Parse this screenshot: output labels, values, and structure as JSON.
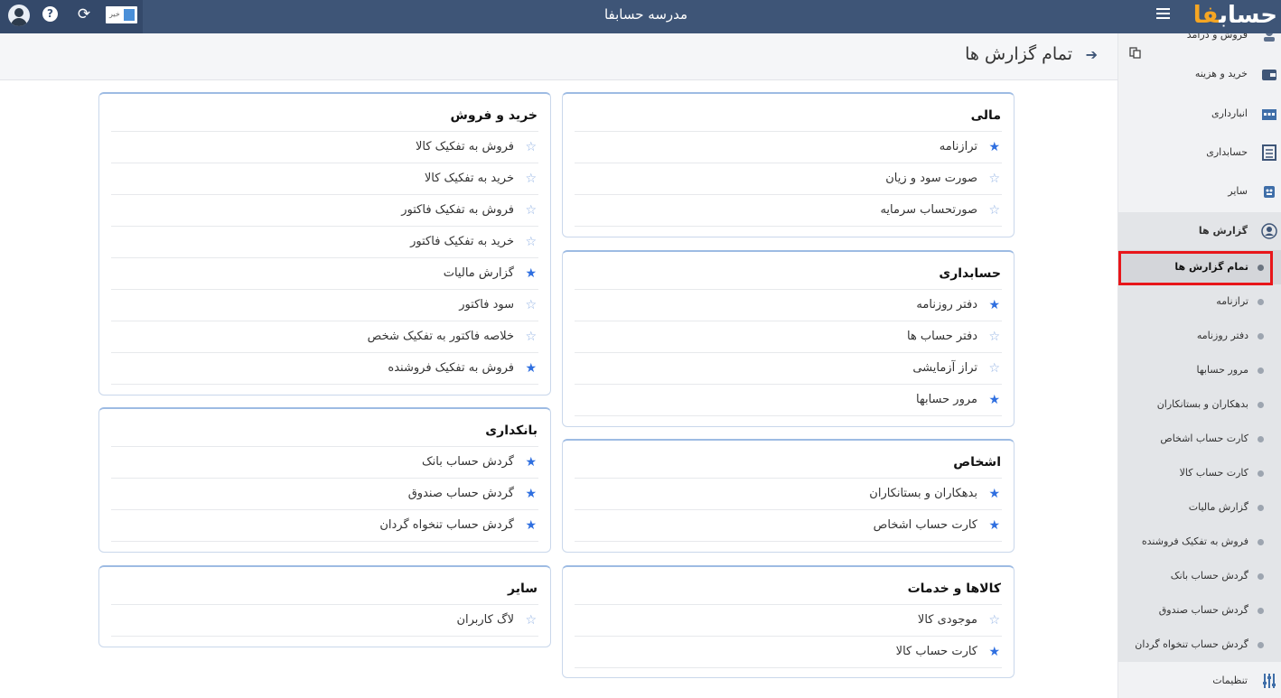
{
  "topbar": {
    "title": "مدرسه حسابفا",
    "toggle_text": "خیر",
    "logo_part1": "حساب",
    "logo_part2": "فا"
  },
  "header": {
    "title": "تمام گزارش ها",
    "back_icon": "arrow-right-icon"
  },
  "sidebar": {
    "items": [
      {
        "label": "فروش و درآمد",
        "icon": "coins-icon"
      },
      {
        "label": "خرید و هزینه",
        "icon": "wallet-icon"
      },
      {
        "label": "انبارداری",
        "icon": "warehouse-icon"
      },
      {
        "label": "حسابداری",
        "icon": "ledger-icon"
      },
      {
        "label": "سایر",
        "icon": "other-icon"
      },
      {
        "label": "گزارش ها",
        "icon": "report-icon"
      }
    ],
    "reports_sub": [
      {
        "label": "تمام گزارش ها"
      },
      {
        "label": "ترازنامه"
      },
      {
        "label": "دفتر روزنامه"
      },
      {
        "label": "مرور حسابها"
      },
      {
        "label": "بدهکاران و بستانکاران"
      },
      {
        "label": "کارت حساب اشخاص"
      },
      {
        "label": "کارت حساب کالا"
      },
      {
        "label": "گزارش مالیات"
      },
      {
        "label": "فروش به تفکیک فروشنده"
      },
      {
        "label": "گردش حساب بانک"
      },
      {
        "label": "گردش حساب صندوق"
      },
      {
        "label": "گردش حساب تنخواه گردان"
      }
    ],
    "settings": {
      "label": "تنظیمات",
      "icon": "sliders-icon"
    }
  },
  "cards": {
    "mali": {
      "title": "مالی",
      "rows": [
        {
          "label": "ترازنامه",
          "starred": true
        },
        {
          "label": "صورت سود و زیان",
          "starred": false
        },
        {
          "label": "صورتحساب سرمایه",
          "starred": false
        }
      ]
    },
    "hesabdari": {
      "title": "حسابداری",
      "rows": [
        {
          "label": "دفتر روزنامه",
          "starred": true
        },
        {
          "label": "دفتر حساب ها",
          "starred": false
        },
        {
          "label": "تراز آزمایشی",
          "starred": false
        },
        {
          "label": "مرور حسابها",
          "starred": true
        }
      ]
    },
    "ashkhas": {
      "title": "اشخاص",
      "rows": [
        {
          "label": "بدهکاران و بستانکاران",
          "starred": true
        },
        {
          "label": "کارت حساب اشخاص",
          "starred": true
        }
      ]
    },
    "kala": {
      "title": "کالاها و خدمات",
      "rows": [
        {
          "label": "موجودی کالا",
          "starred": false
        },
        {
          "label": "کارت حساب کالا",
          "starred": true
        }
      ]
    },
    "kharid_foroosh": {
      "title": "خرید و فروش",
      "rows": [
        {
          "label": "فروش به تفکیک کالا",
          "starred": false
        },
        {
          "label": "خرید به تفکیک کالا",
          "starred": false
        },
        {
          "label": "فروش به تفکیک فاکتور",
          "starred": false
        },
        {
          "label": "خرید به تفکیک فاکتور",
          "starred": false
        },
        {
          "label": "گزارش مالیات",
          "starred": true
        },
        {
          "label": "سود فاکتور",
          "starred": false
        },
        {
          "label": "خلاصه فاکتور به تفکیک شخص",
          "starred": false
        },
        {
          "label": "فروش به تفکیک فروشنده",
          "starred": true
        }
      ]
    },
    "bankdari": {
      "title": "بانکداری",
      "rows": [
        {
          "label": "گردش حساب بانک",
          "starred": true
        },
        {
          "label": "گردش حساب صندوق",
          "starred": true
        },
        {
          "label": "گردش حساب تنخواه گردان",
          "starred": true
        }
      ]
    },
    "sayer": {
      "title": "سایر",
      "rows": [
        {
          "label": "لاگ کاربران",
          "starred": false
        }
      ]
    }
  }
}
